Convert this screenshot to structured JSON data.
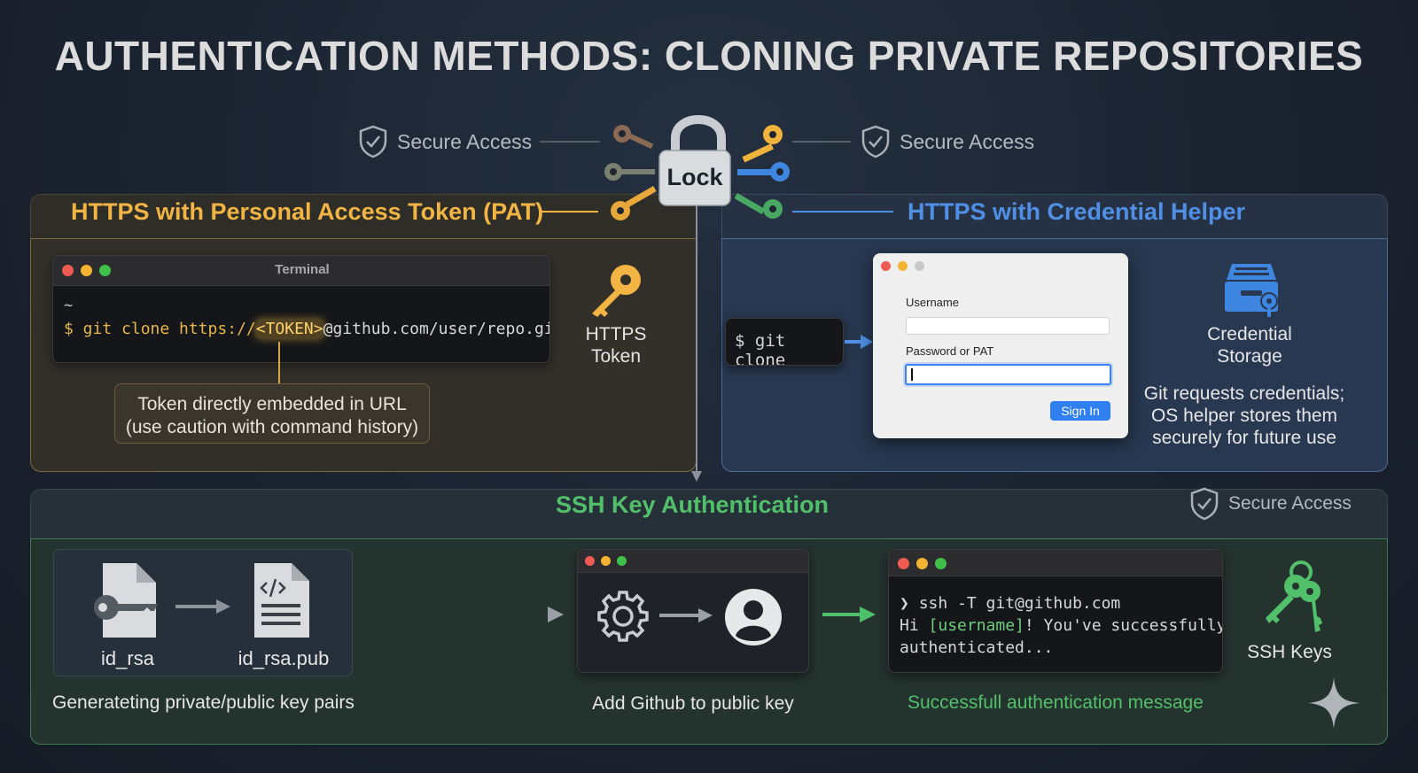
{
  "title": "AUTHENTICATION METHODS: CLONING PRIVATE REPOSITORIES",
  "secure_access": [
    "Secure Access",
    "Secure Access",
    "Secure Access"
  ],
  "lock_label": "Lock",
  "colors": {
    "pat": "#f2b544",
    "cred": "#4f8fe6",
    "ssh": "#52c06a"
  },
  "pat": {
    "title": "HTTPS with Personal Access Token (PAT)",
    "terminal_title": "Terminal",
    "prompt_tilde": "~",
    "cmd_prefix": "$ git clone ",
    "cmd_url_start": "https://",
    "cmd_token": "<TOKEN>",
    "cmd_url_end": "@github.com/user/repo.git",
    "callout_line1": "Token directly embedded in URL",
    "callout_line2": "(use caution with command history)",
    "side_label_line1": "HTTPS",
    "side_label_line2": "Token",
    "side_icon": "key-icon"
  },
  "cred": {
    "title": "HTTPS with Credential Helper",
    "command": "$ git clone",
    "username_label": "Username",
    "password_label": "Password or PAT",
    "signin_label": "Sign In",
    "storage_label_line1": "Credential",
    "storage_label_line2": "Storage",
    "desc_line1": "Git requests credentials;",
    "desc_line2": "OS helper stores them",
    "desc_line3": "securely for future use",
    "storage_icon": "storage-box-icon"
  },
  "ssh": {
    "title": "SSH Key Authentication",
    "private_key": "id_rsa",
    "public_key": "id_rsa.pub",
    "step1_caption": "Generateting private/public key pairs",
    "step2_caption": "Add Github to public key",
    "step3_caption": "Successfull authentication message",
    "term_line1_prompt": "❯ ",
    "term_line1_cmd": "ssh -T git@github.com",
    "term_line2_a": "Hi ",
    "term_line2_user": "[username]",
    "term_line2_b": "! You've successfully",
    "term_line3": "authenticated...",
    "keys_label": "SSH Keys",
    "keys_icon": "key-ring-icon"
  }
}
